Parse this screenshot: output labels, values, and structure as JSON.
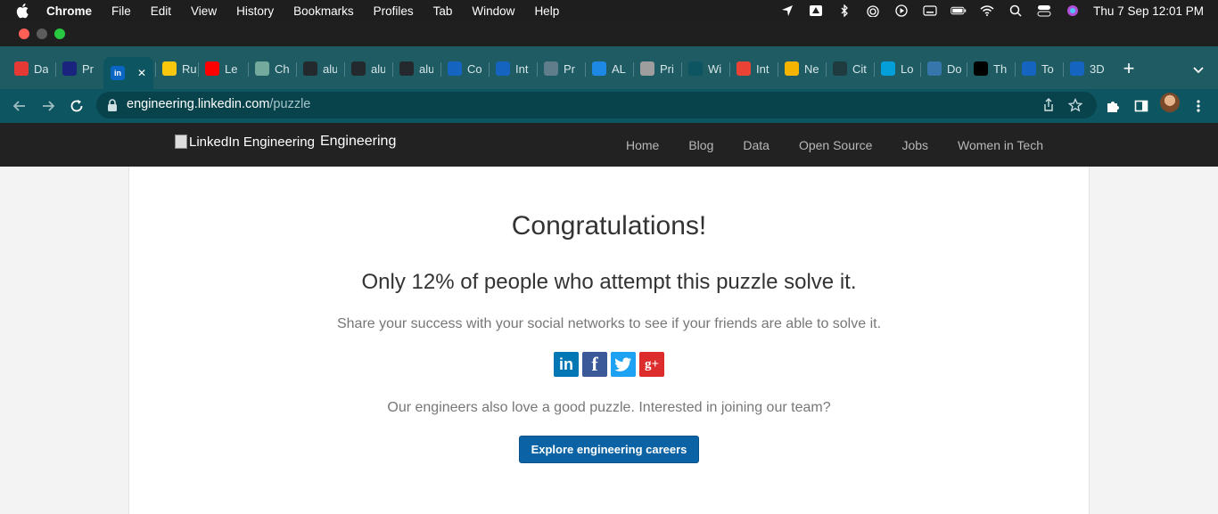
{
  "menubar": {
    "app": "Chrome",
    "items": [
      "File",
      "Edit",
      "View",
      "History",
      "Bookmarks",
      "Profiles",
      "Tab",
      "Window",
      "Help"
    ],
    "clock": "Thu 7 Sep  12:01 PM"
  },
  "tabs": [
    {
      "label": "Da",
      "icon": "red-ring-icon",
      "color": "#e53935"
    },
    {
      "label": "Pr",
      "icon": "blue-logo-icon",
      "color": "#1a237e"
    },
    {
      "label": "in",
      "icon": "linkedin-icon",
      "color": "#0a66c2",
      "active": true
    },
    {
      "label": "Ru",
      "icon": "r-logo-icon",
      "color": "#f9c80e"
    },
    {
      "label": "Le",
      "icon": "youtube-icon",
      "color": "#ff0000"
    },
    {
      "label": "Ch",
      "icon": "chatgpt-icon",
      "color": "#74aa9c"
    },
    {
      "label": "alu",
      "icon": "github-icon",
      "color": "#24292e"
    },
    {
      "label": "alu",
      "icon": "github-icon",
      "color": "#24292e"
    },
    {
      "label": "alu",
      "icon": "github-icon",
      "color": "#24292e"
    },
    {
      "label": "Co",
      "icon": "c-logo-icon",
      "color": "#1565c0"
    },
    {
      "label": "Int",
      "icon": "c-logo-icon",
      "color": "#1565c0"
    },
    {
      "label": "Pr",
      "icon": "globe-icon",
      "color": "#607d8b"
    },
    {
      "label": "AL",
      "icon": "calendar-icon",
      "color": "#1e88e5"
    },
    {
      "label": "Pri",
      "icon": "dots-icon",
      "color": "#9e9e9e"
    },
    {
      "label": "Wi",
      "icon": "dark-logo-icon",
      "color": "#0d5560"
    },
    {
      "label": "Int",
      "icon": "gmail-icon",
      "color": "#ea4335"
    },
    {
      "label": "Ne",
      "icon": "slides-icon",
      "color": "#f4b400"
    },
    {
      "label": "Cit",
      "icon": "cisco-icon",
      "color": "#1f3b40"
    },
    {
      "label": "Lo",
      "icon": "cisco-logo-icon",
      "color": "#049fd9"
    },
    {
      "label": "Do",
      "icon": "python-icon",
      "color": "#3776ab"
    },
    {
      "label": "Th",
      "icon": "terminal-icon",
      "color": "#000000"
    },
    {
      "label": "To",
      "icon": "c-logo-icon",
      "color": "#1565c0"
    },
    {
      "label": "3D",
      "icon": "c-logo-icon",
      "color": "#1565c0"
    }
  ],
  "address_bar": {
    "domain": "engineering.linkedin.com",
    "path": "/puzzle"
  },
  "site": {
    "logo_alt": "LinkedIn Engineering",
    "logo_name": "Engineering",
    "nav": [
      "Home",
      "Blog",
      "Data",
      "Open Source",
      "Jobs",
      "Women in Tech"
    ]
  },
  "content": {
    "heading": "Congratulations!",
    "stat": "Only 12% of people who attempt this puzzle solve it.",
    "share_prompt": "Share your success with your social networks to see if your friends are able to solve it.",
    "social": [
      {
        "name": "linkedin",
        "glyph": "in"
      },
      {
        "name": "facebook",
        "glyph": "f"
      },
      {
        "name": "twitter",
        "glyph": ""
      },
      {
        "name": "google-plus",
        "glyph": "g+"
      }
    ],
    "careers_prompt": "Our engineers also love a good puzzle. Interested in joining our team?",
    "cta_label": "Explore engineering careers"
  },
  "colors": {
    "tabstrip": "#1f5b63",
    "toolbar": "#0d5560",
    "site_header": "#222222",
    "cta": "#0b63a5"
  }
}
